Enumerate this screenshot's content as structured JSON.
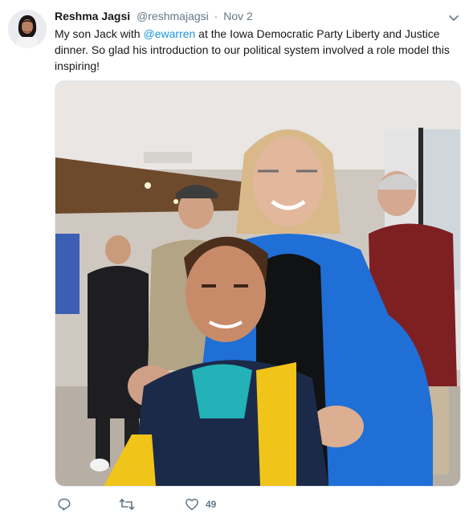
{
  "tweet": {
    "author_name": "Reshma Jagsi",
    "author_handle": "@reshmajagsi",
    "separator": "·",
    "timestamp": "Nov 2",
    "text_before": "My son Jack with ",
    "mention": "@ewarren",
    "text_after": " at the Iowa Democratic Party Liberty and Justice dinner.  So glad his introduction to our political system involved a role model this inspiring!",
    "likes_count": "49"
  },
  "colors": {
    "link": "#1b95e0",
    "secondary_text": "#657786",
    "primary_text": "#14171a",
    "jacket_blue": "#1f6fd6",
    "sweater_red": "#7e1f22",
    "hoodie_yellow": "#f0c419",
    "hoodie_navy": "#1c2a49"
  },
  "icons": {
    "caret": "chevron-down-icon",
    "reply": "reply-icon",
    "retweet": "retweet-icon",
    "like": "heart-icon"
  }
}
